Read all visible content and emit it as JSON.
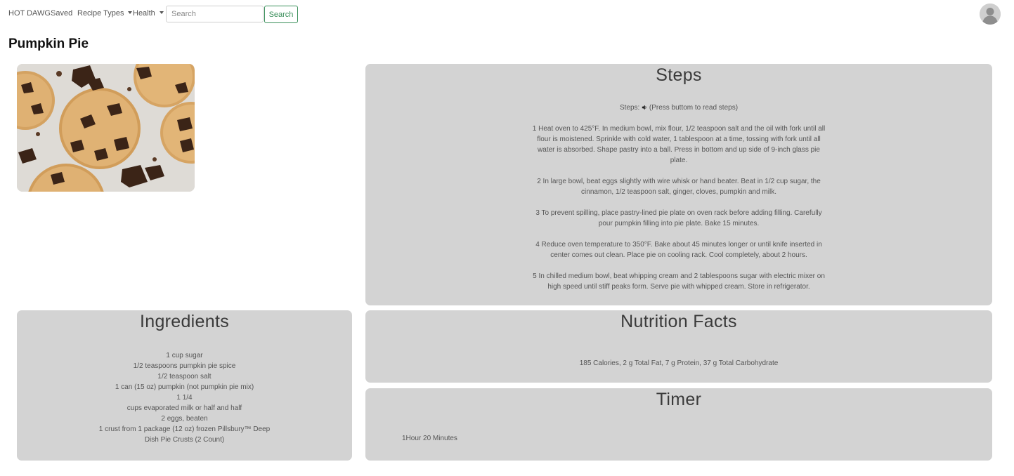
{
  "navbar": {
    "brand": "HOT DAWG",
    "saved_label": "Saved",
    "recipe_types_label": "Recipe Types",
    "health_label": "Health",
    "search_placeholder": "Search",
    "search_button_label": "Search",
    "avatar_icon": "user-avatar-icon"
  },
  "recipe": {
    "title": "Pumpkin Pie",
    "image_icon": "cookies-photo"
  },
  "steps": {
    "title": "Steps",
    "label_prefix": "Steps:",
    "label_suffix": "(Press buttom to read steps)",
    "speaker_icon": "speaker-icon",
    "items": [
      "1 Heat oven to 425°F. In medium bowl, mix flour, 1/2 teaspoon salt and the oil with fork until all flour is moistened. Sprinkle with cold water, 1 tablespoon at a time, tossing with fork until all water is absorbed. Shape pastry into a ball. Press in bottom and up side of 9-inch glass pie plate.",
      "2 In large bowl, beat eggs slightly with wire whisk or hand beater. Beat in 1/2 cup sugar, the cinnamon, 1/2 teaspoon salt, ginger, cloves, pumpkin and milk.",
      "3 To prevent spilling, place pastry-lined pie plate on oven rack before adding filling. Carefully pour pumpkin filling into pie plate. Bake 15 minutes.",
      "4 Reduce oven temperature to 350°F. Bake about 45 minutes longer or until knife inserted in center comes out clean. Place pie on cooling rack. Cool completely, about 2 hours.",
      "5 In chilled medium bowl, beat whipping cream and 2 tablespoons sugar with electric mixer on high speed until stiff peaks form. Serve pie with whipped cream. Store in refrigerator."
    ]
  },
  "ingredients": {
    "title": "Ingredients",
    "items": [
      "1 cup sugar",
      "1/2 teaspoons pumpkin pie spice",
      "1/2 teaspoon salt",
      "1 can (15 oz) pumpkin (not pumpkin pie mix)",
      "1 1/4",
      "cups evaporated milk or half and half",
      "2 eggs, beaten",
      "1 crust from 1 package (12 oz) frozen Pillsbury™ Deep Dish Pie Crusts (2 Count)"
    ]
  },
  "nutrition": {
    "title": "Nutrition Facts",
    "text": "185 Calories, 2 g Total Fat, 7 g Protein, 37 g Total Carbohydrate"
  },
  "timer": {
    "title": "Timer",
    "text": "1Hour 20 Minutes"
  }
}
